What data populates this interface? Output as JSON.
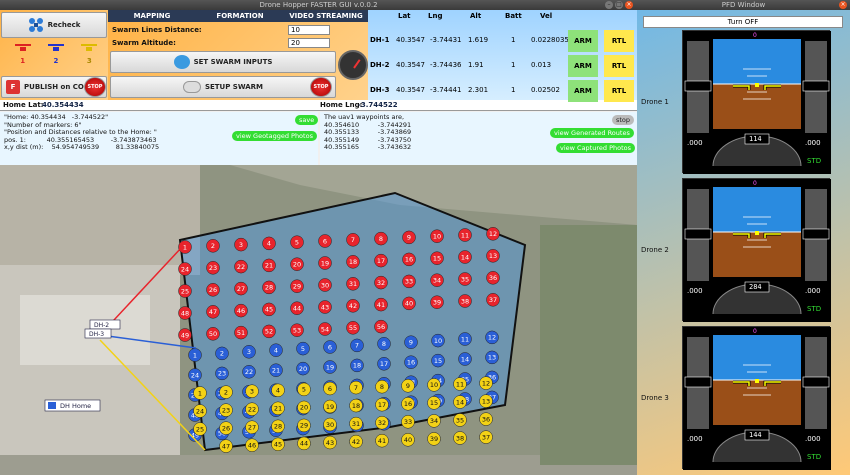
{
  "window_title": "Drone Hopper FASTER GUI v.0.0.2",
  "pfd_window_title": "PFD Window",
  "buttons": {
    "recheck": "Recheck",
    "publish": "PUBLISH on COP",
    "set_swarm_inputs": "SET SWARM INPUTS",
    "setup_swarm": "SETUP SWARM",
    "stop": "STOP",
    "save": "save",
    "stop_small": "stop",
    "view_geotagged": "view Geotagged Photos",
    "view_generated": "view Generated Routes",
    "view_captured": "view Captured Photos",
    "turn_off": "Turn OFF"
  },
  "tabs": [
    "MAPPING",
    "FORMATION",
    "VIDEO STREAMING"
  ],
  "swarm": {
    "lines_label": "Swarm Lines Distance:",
    "lines_value": "10",
    "altitude_label": "Swarm Altitude:",
    "altitude_value": "20"
  },
  "drone_icon_numbers": [
    "1",
    "2",
    "3"
  ],
  "telemetry": {
    "headers": [
      "Lat",
      "Lng",
      "Alt",
      "Batt",
      "Vel"
    ],
    "rows": [
      {
        "name": "DH-1",
        "lat": "40.3547",
        "lng": "-3.74431",
        "alt": "1.619",
        "batt": "1",
        "vel": "0.0228035",
        "arm": "ARM",
        "rtl": "RTL"
      },
      {
        "name": "DH-2",
        "lat": "40.3547",
        "lng": "-3.74436",
        "alt": "1.91",
        "batt": "1",
        "vel": "0.013",
        "arm": "ARM",
        "rtl": "RTL"
      },
      {
        "name": "DH-3",
        "lat": "40.3547",
        "lng": "-3.74441",
        "alt": "2.301",
        "batt": "1",
        "vel": "0.02502",
        "arm": "ARM",
        "rtl": "RTL"
      }
    ]
  },
  "home": {
    "lat_label": "Home Lat:",
    "lat_value": "40.354434",
    "lng_label": "Home Lng:",
    "lng_value": "-3.744522"
  },
  "left_text": [
    "\"Home: 40.354434   -3.744522\"",
    "\"Number of markers: 6\"",
    "\"Position and Distances relative to the Home: \"",
    "pos. 1:          40.355165453        -3.743873463",
    "x,y dist (m):    54.954749539        81.33840075"
  ],
  "right_text": [
    "The uav1 waypoints are,",
    "40.354610         -3.744291",
    "40.355133         -3.743869",
    "40.355149         -3.743750",
    "40.355165         -3.743632"
  ],
  "map": {
    "home_label": "DH Home",
    "drone_labels": [
      "DH-2",
      "DH-3"
    ],
    "red_waypoints": [
      "1",
      "2",
      "3",
      "4",
      "5",
      "6",
      "7",
      "8",
      "9",
      "10",
      "11",
      "12",
      "13",
      "14",
      "15",
      "16",
      "17",
      "18",
      "19",
      "20",
      "21",
      "22",
      "23",
      "24",
      "25",
      "26",
      "27",
      "28",
      "29",
      "30",
      "31",
      "32",
      "33",
      "34",
      "35",
      "36",
      "37",
      "38",
      "39",
      "40",
      "41",
      "42",
      "43",
      "44",
      "45",
      "46",
      "47",
      "48",
      "49",
      "50",
      "51",
      "52",
      "53",
      "54",
      "55",
      "56"
    ],
    "blue_waypoints": [
      "1",
      "2",
      "3",
      "4",
      "5",
      "6",
      "7",
      "8",
      "9",
      "10",
      "11",
      "12",
      "13",
      "14",
      "15",
      "16",
      "17",
      "18",
      "19",
      "20",
      "21",
      "22",
      "23",
      "24",
      "25",
      "26",
      "27",
      "28",
      "29",
      "30",
      "31",
      "32",
      "33",
      "34",
      "35",
      "36",
      "37",
      "38",
      "39",
      "40",
      "41",
      "42",
      "43",
      "44",
      "45",
      "46",
      "47",
      "48",
      "49",
      "50",
      "51",
      "52",
      "53",
      "54",
      "55",
      "56"
    ],
    "yellow_waypoints": [
      "1",
      "2",
      "3",
      "4",
      "5",
      "6",
      "7",
      "8",
      "9",
      "10",
      "11",
      "12",
      "13",
      "14",
      "15",
      "16",
      "17",
      "18",
      "19",
      "20",
      "21",
      "22",
      "23",
      "24",
      "25",
      "26",
      "27",
      "28",
      "29",
      "30",
      "31",
      "32",
      "33",
      "34",
      "35",
      "36",
      "37",
      "38",
      "39",
      "40",
      "41",
      "42",
      "43",
      "44",
      "45",
      "46",
      "47"
    ]
  },
  "drones": [
    {
      "label": "Drone 1",
      "heading": "114",
      "spd": ".000",
      "alt": ".000",
      "std": "STD",
      "tape_top": "0"
    },
    {
      "label": "Drone 2",
      "heading": "284",
      "spd": ".000",
      "alt": ".000",
      "std": "STD",
      "tape_top": "0"
    },
    {
      "label": "Drone 3",
      "heading": "144",
      "spd": ".000",
      "alt": ".000",
      "std": "STD",
      "tape_top": "0"
    }
  ],
  "colors": {
    "arm_green": "#8ee27a",
    "rtl_yellow": "#ffe84d",
    "waypoint_red": "#e8242c",
    "waypoint_blue": "#2a5fd6",
    "waypoint_yellow": "#f3d216"
  }
}
